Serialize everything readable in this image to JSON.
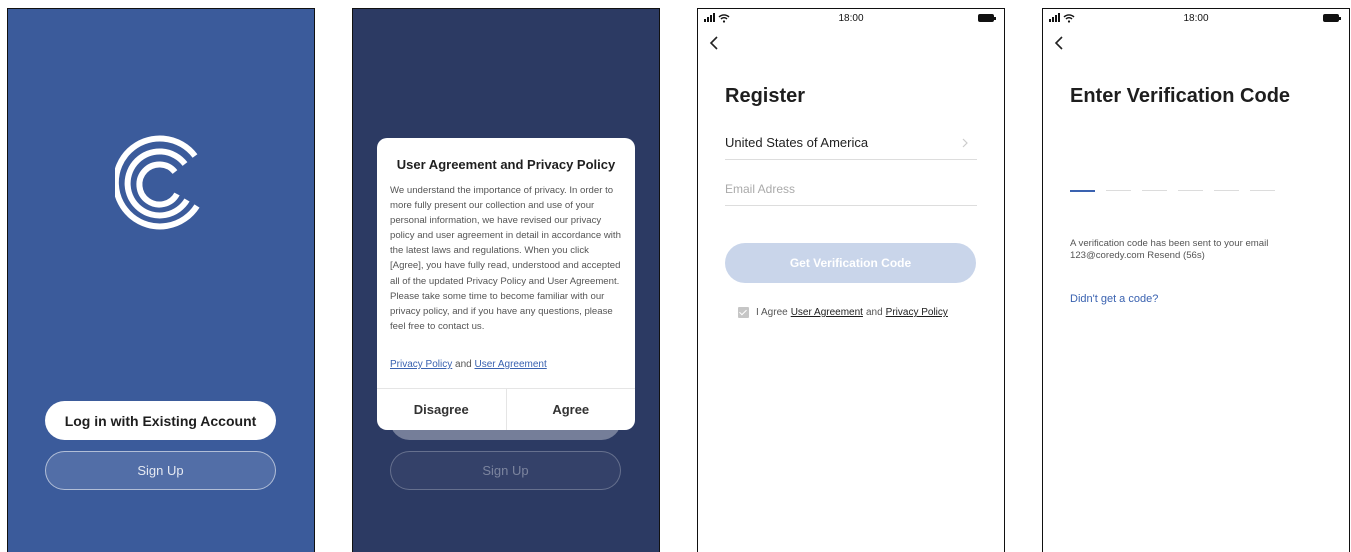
{
  "screen1": {
    "login_label": "Log in with Existing Account",
    "signup_label": "Sign Up"
  },
  "screen2": {
    "dialog_title": "User Agreement and Privacy Policy",
    "dialog_body": "We understand the importance of privacy. In order to more fully present our collection and use of your personal information, we have revised our privacy policy and user agreement in detail in accordance with the latest laws and regulations. When you click [Agree], you have fully read, understood and accepted all of the updated Privacy Policy and User Agreement. Please take some time to become familiar with our privacy policy, and if you have any questions, please feel free to contact us.",
    "link_privacy": "Privacy Policy",
    "link_and": "and",
    "link_agreement": "User Agreement",
    "disagree_label": "Disagree",
    "agree_label": "Agree",
    "signup_label": "Sign Up"
  },
  "status_bar": {
    "time": "18:00"
  },
  "screen3": {
    "title": "Register",
    "country": "United States of America",
    "email_placeholder": "Email Adress",
    "code_button": "Get Verification Code",
    "agree_prefix": "I Agree",
    "agree_link1": "User Agreement",
    "agree_and": "and",
    "agree_link2": "Privacy Policy"
  },
  "screen4": {
    "title": "Enter Verification Code",
    "sent_line1": "A verification code has been sent to your email",
    "sent_line2": "123@coredy.com  Resend (56s)",
    "no_code": "Didn't get a code?"
  },
  "colors": {
    "screen1_bg": "#3b5b9b",
    "screen2_bg": "#2c3a63",
    "accent": "#3a62b0",
    "disabled_button": "#c9d5ea"
  },
  "icons": [
    "app-logo-icon",
    "back-arrow-icon",
    "chevron-right-icon",
    "signal-icon",
    "wifi-icon",
    "battery-icon",
    "checkbox-icon"
  ]
}
